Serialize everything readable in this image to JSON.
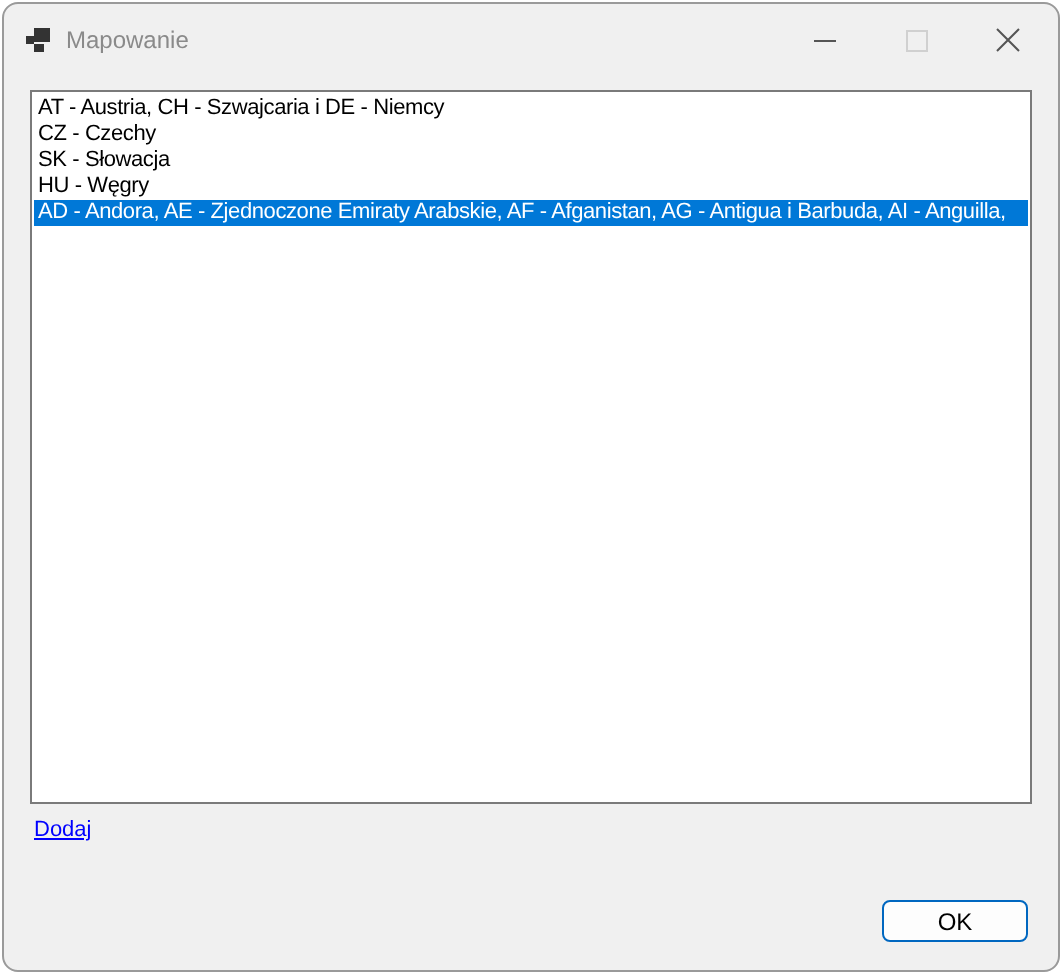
{
  "window": {
    "title": "Mapowanie",
    "maximize_disabled": true
  },
  "list": {
    "items": [
      {
        "label": "AT - Austria, CH - Szwajcaria i DE - Niemcy",
        "selected": false
      },
      {
        "label": "CZ - Czechy",
        "selected": false
      },
      {
        "label": "SK - Słowacja",
        "selected": false
      },
      {
        "label": "HU - Węgry",
        "selected": false
      },
      {
        "label": "AD - Andora, AE - Zjednoczone Emiraty Arabskie, AF - Afganistan, AG - Antigua i Barbuda, AI - Anguilla,",
        "selected": true
      }
    ]
  },
  "link": "Dodaj",
  "buttons": [
    "OK"
  ]
}
